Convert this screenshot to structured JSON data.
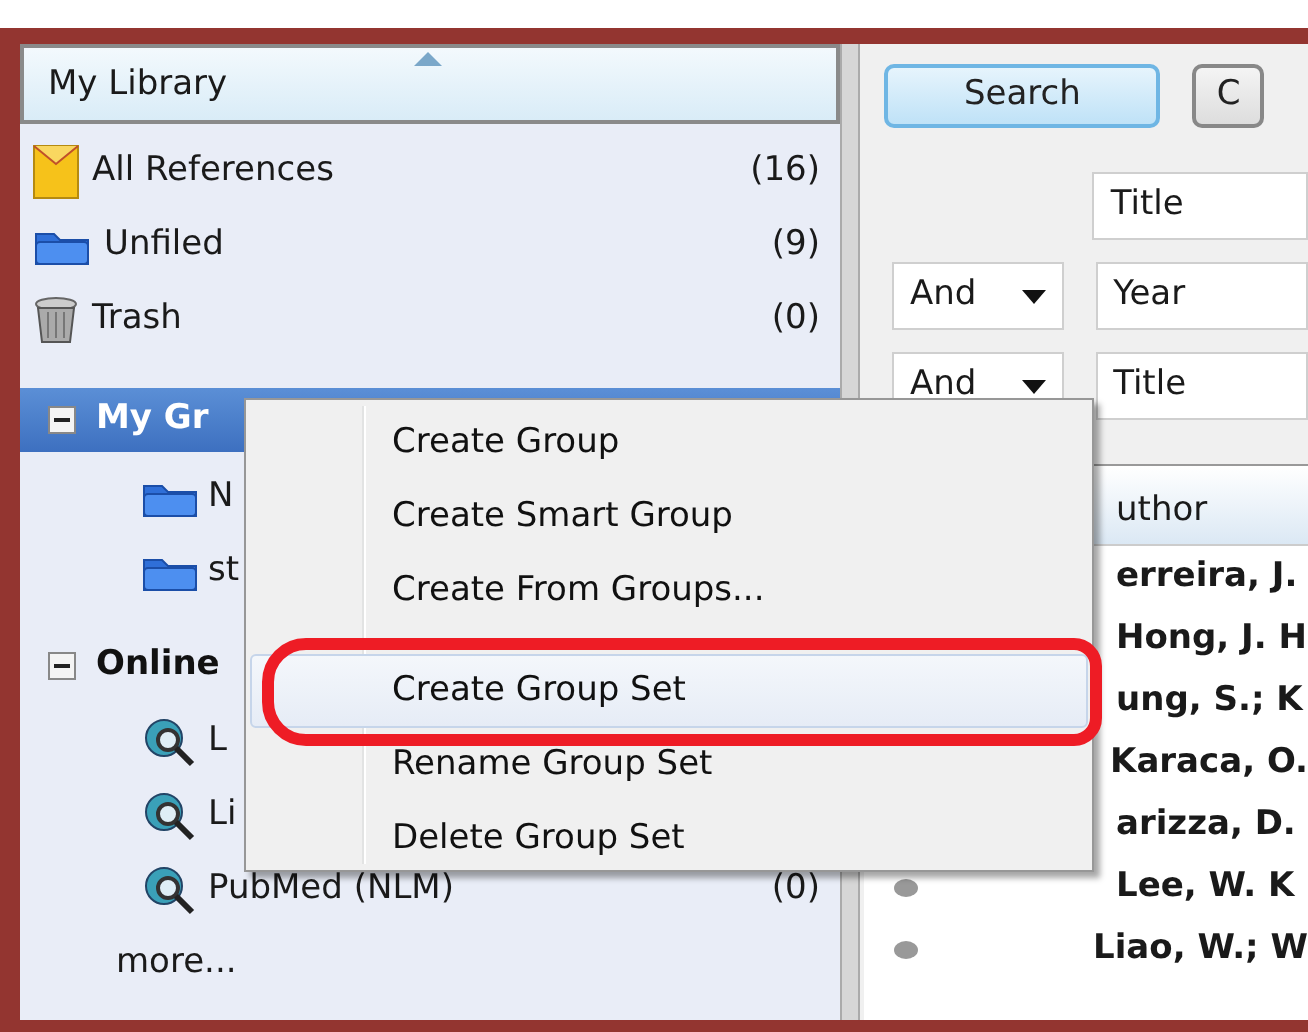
{
  "sidebar": {
    "header": "My Library",
    "items": [
      {
        "kind": "envelope",
        "label": "All References",
        "count": "(16)"
      },
      {
        "kind": "folder",
        "label": "Unfiled",
        "count": "(9)"
      },
      {
        "kind": "trash",
        "label": "Trash",
        "count": "(0)"
      }
    ],
    "groups_header": {
      "label": "My Gr",
      "expanded": true,
      "selected": true
    },
    "groups": [
      {
        "label": "N"
      },
      {
        "label": "st"
      }
    ],
    "online_header": {
      "label": "Online",
      "expanded": true
    },
    "online": [
      {
        "label": "L"
      },
      {
        "label": "Li"
      },
      {
        "label": "PubMed (NLM)",
        "count": "(0)"
      }
    ],
    "more": "more..."
  },
  "search": {
    "buttons": [
      "Search",
      "C"
    ],
    "rows": [
      {
        "operator": "",
        "field": "Title"
      },
      {
        "operator": "And",
        "field": "Year"
      },
      {
        "operator": "And",
        "field": "Title"
      }
    ]
  },
  "results": {
    "column": "uthor",
    "rows": [
      {
        "author": "erreira, J."
      },
      {
        "author": "Hong, J. H"
      },
      {
        "author": "ung, S.; K"
      },
      {
        "author": "Karaca, O."
      },
      {
        "author": "arizza, D."
      },
      {
        "author": "Lee, W. K"
      },
      {
        "author": "Liao, W.; W"
      }
    ]
  },
  "context_menu": {
    "items": [
      {
        "kind": "item",
        "label": "Create Group",
        "selected": false,
        "circled": false
      },
      {
        "kind": "item",
        "label": "Create Smart Group",
        "selected": false,
        "circled": false
      },
      {
        "kind": "item",
        "label": "Create From Groups...",
        "selected": false,
        "circled": false
      },
      {
        "kind": "separator"
      },
      {
        "kind": "item",
        "label": "Create Group Set",
        "selected": true,
        "circled": true
      },
      {
        "kind": "item",
        "label": "Rename Group Set",
        "selected": false,
        "circled": false
      },
      {
        "kind": "item",
        "label": "Delete Group Set",
        "selected": false,
        "circled": false
      }
    ]
  }
}
